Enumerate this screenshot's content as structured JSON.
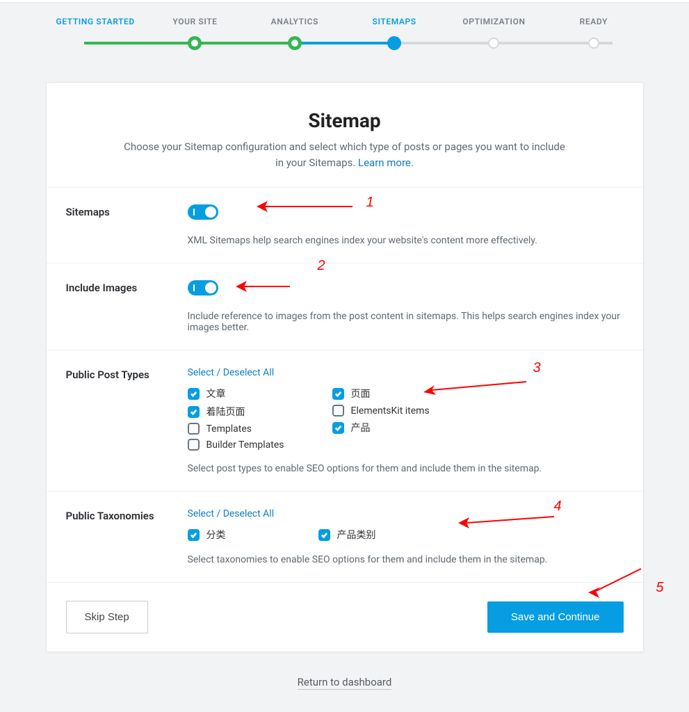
{
  "stepper": {
    "steps": [
      {
        "label": "GETTING STARTED"
      },
      {
        "label": "YOUR SITE"
      },
      {
        "label": "ANALYTICS"
      },
      {
        "label": "SITEMAPS"
      },
      {
        "label": "OPTIMIZATION"
      },
      {
        "label": "READY"
      }
    ]
  },
  "header": {
    "title": "Sitemap",
    "subtitle": "Choose your Sitemap configuration and select which type of posts or pages you want to include in your Sitemaps. ",
    "learn_more": "Learn more."
  },
  "sections": {
    "sitemaps": {
      "label": "Sitemaps",
      "toggle": true,
      "desc": "XML Sitemaps help search engines index your website's content more effectively."
    },
    "images": {
      "label": "Include Images",
      "toggle": true,
      "desc": "Include reference to images from the post content in sitemaps. This helps search engines index your images better."
    },
    "post_types": {
      "label": "Public Post Types",
      "select_all": "Select / Deselect All",
      "col1": [
        {
          "label": "文章",
          "checked": true
        },
        {
          "label": "着陆页面",
          "checked": true
        },
        {
          "label": "Templates",
          "checked": false
        },
        {
          "label": "Builder Templates",
          "checked": false
        }
      ],
      "col2": [
        {
          "label": "页面",
          "checked": true
        },
        {
          "label": "ElementsKit items",
          "checked": false
        },
        {
          "label": "产品",
          "checked": true
        }
      ],
      "desc": "Select post types to enable SEO options for them and include them in the sitemap."
    },
    "taxonomies": {
      "label": "Public Taxonomies",
      "select_all": "Select / Deselect All",
      "items": [
        {
          "label": "分类",
          "checked": true
        },
        {
          "label": "产品类别",
          "checked": true
        }
      ],
      "desc": "Select taxonomies to enable SEO options for them and include them in the sitemap."
    }
  },
  "footer": {
    "skip": "Skip Step",
    "save": "Save and Continue",
    "return": "Return to dashboard"
  },
  "annotations": {
    "n1": "1",
    "n2": "2",
    "n3": "3",
    "n4": "4",
    "n5": "5"
  }
}
